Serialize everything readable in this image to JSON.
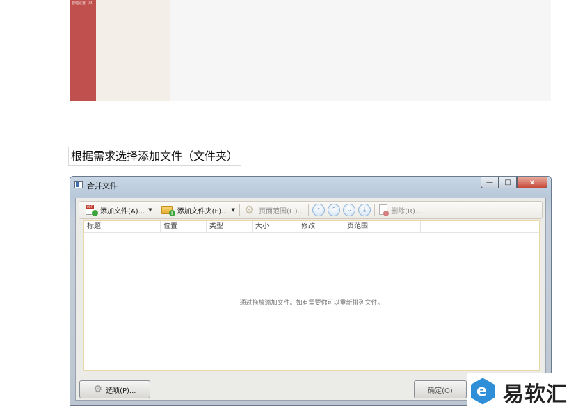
{
  "top_screenshot": {
    "sidebar_text": "管理设置（M）"
  },
  "caption": "根据需求选择添加文件（文件夹）",
  "window": {
    "title": "合并文件",
    "controls": {
      "minimize": "—",
      "maximize": "□",
      "close": "x"
    },
    "toolbar": {
      "add_file": "添加文件(A)...",
      "add_folder": "添加文件夹(F)...",
      "page_range": "页面范围(G)...",
      "move_top": "⤒",
      "move_up": "⌃",
      "move_down": "⌄",
      "move_bottom": "⤓",
      "delete": "删除(R)..."
    },
    "table": {
      "columns": [
        "标题",
        "位置",
        "类型",
        "大小",
        "修改",
        "页范围"
      ],
      "empty_message": "通过拖放添加文件。如有需要你可以重新排列文件。"
    },
    "buttons": {
      "options": "选项(P)...",
      "ok": "确定(O)"
    }
  },
  "watermark": {
    "logo_letter": "e",
    "text": "易软汇"
  },
  "colors": {
    "sidebar_red": "#c0504d",
    "window_frame": "#c8d6e5",
    "table_border": "#e9d9a9",
    "close_button": "#c5483a",
    "watermark_blue": "#2e8fd8"
  }
}
